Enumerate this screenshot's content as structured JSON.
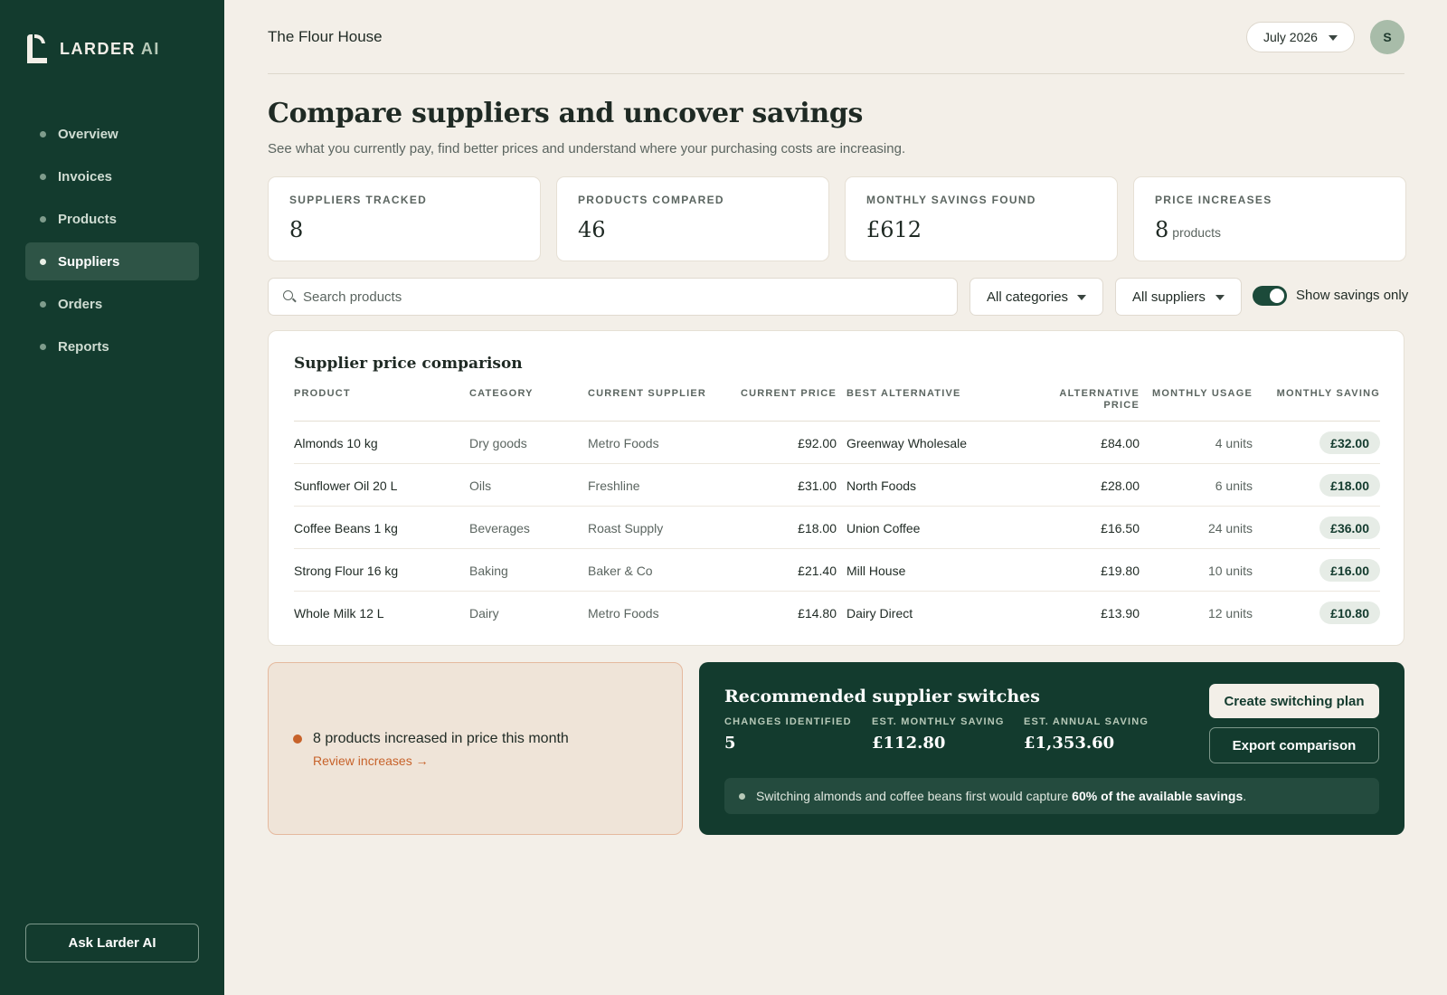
{
  "brand": {
    "name": "LARDER",
    "suffix": "AI"
  },
  "sidebar": {
    "items": [
      {
        "label": "Overview",
        "active": false
      },
      {
        "label": "Invoices",
        "active": false
      },
      {
        "label": "Products",
        "active": false
      },
      {
        "label": "Suppliers",
        "active": true
      },
      {
        "label": "Orders",
        "active": false
      },
      {
        "label": "Reports",
        "active": false
      }
    ],
    "ask_button": "Ask Larder AI"
  },
  "header": {
    "workspace": "The Flour House",
    "month": "July 2026",
    "avatar_initial": "S"
  },
  "page": {
    "title": "Compare suppliers and uncover savings",
    "subtitle": "See what you currently pay, find better prices and understand where your purchasing costs are increasing."
  },
  "stats": [
    {
      "label": "SUPPLIERS TRACKED",
      "value": "8",
      "unit": ""
    },
    {
      "label": "PRODUCTS COMPARED",
      "value": "46",
      "unit": ""
    },
    {
      "label": "MONTHLY SAVINGS FOUND",
      "value": "£612",
      "unit": ""
    },
    {
      "label": "PRICE INCREASES",
      "value": "8",
      "unit": "products"
    }
  ],
  "filters": {
    "search_placeholder": "Search products",
    "category": "All categories",
    "supplier": "All suppliers",
    "toggle_label": "Show savings only",
    "toggle_on": true
  },
  "table": {
    "title": "Supplier price comparison",
    "headers": {
      "product": "PRODUCT",
      "category": "CATEGORY",
      "current_supplier": "CURRENT SUPPLIER",
      "current_price": "CURRENT PRICE",
      "best_alternative": "BEST ALTERNATIVE",
      "alternative_price_1": "ALTERNATIVE",
      "alternative_price_2": "PRICE",
      "monthly_usage": "MONTHLY USAGE",
      "monthly_saving": "MONTHLY SAVING"
    },
    "rows": [
      {
        "product": "Almonds 10 kg",
        "category": "Dry goods",
        "current_supplier": "Metro Foods",
        "current_price": "£92.00",
        "best_alternative": "Greenway Wholesale",
        "alternative_price": "£84.00",
        "monthly_usage": "4 units",
        "monthly_saving": "£32.00"
      },
      {
        "product": "Sunflower Oil 20 L",
        "category": "Oils",
        "current_supplier": "Freshline",
        "current_price": "£31.00",
        "best_alternative": "North Foods",
        "alternative_price": "£28.00",
        "monthly_usage": "6 units",
        "monthly_saving": "£18.00"
      },
      {
        "product": "Coffee Beans 1 kg",
        "category": "Beverages",
        "current_supplier": "Roast Supply",
        "current_price": "£18.00",
        "best_alternative": "Union Coffee",
        "alternative_price": "£16.50",
        "monthly_usage": "24 units",
        "monthly_saving": "£36.00"
      },
      {
        "product": "Strong Flour 16 kg",
        "category": "Baking",
        "current_supplier": "Baker & Co",
        "current_price": "£21.40",
        "best_alternative": "Mill House",
        "alternative_price": "£19.80",
        "monthly_usage": "10 units",
        "monthly_saving": "£16.00"
      },
      {
        "product": "Whole Milk 12 L",
        "category": "Dairy",
        "current_supplier": "Metro Foods",
        "current_price": "£14.80",
        "best_alternative": "Dairy Direct",
        "alternative_price": "£13.90",
        "monthly_usage": "12 units",
        "monthly_saving": "£10.80"
      }
    ]
  },
  "alert": {
    "text": "8 products increased in price this month",
    "link": "Review increases →"
  },
  "recommendation": {
    "title": "Recommended supplier switches",
    "metrics": [
      {
        "label": "CHANGES IDENTIFIED",
        "value": "5"
      },
      {
        "label": "EST. MONTHLY SAVING",
        "value": "£112.80"
      },
      {
        "label": "EST. ANNUAL SAVING",
        "value": "£1,353.60"
      }
    ],
    "primary_button": "Create switching plan",
    "secondary_button": "Export comparison",
    "note_prefix": "Switching almonds and coffee beans first would capture ",
    "note_bold": "60% of the available savings",
    "note_suffix": "."
  },
  "colors": {
    "sidebar": "#133b2e",
    "background": "#f3efe8",
    "accent_orange": "#c7622a",
    "saving_pill": "#e6ece6"
  }
}
